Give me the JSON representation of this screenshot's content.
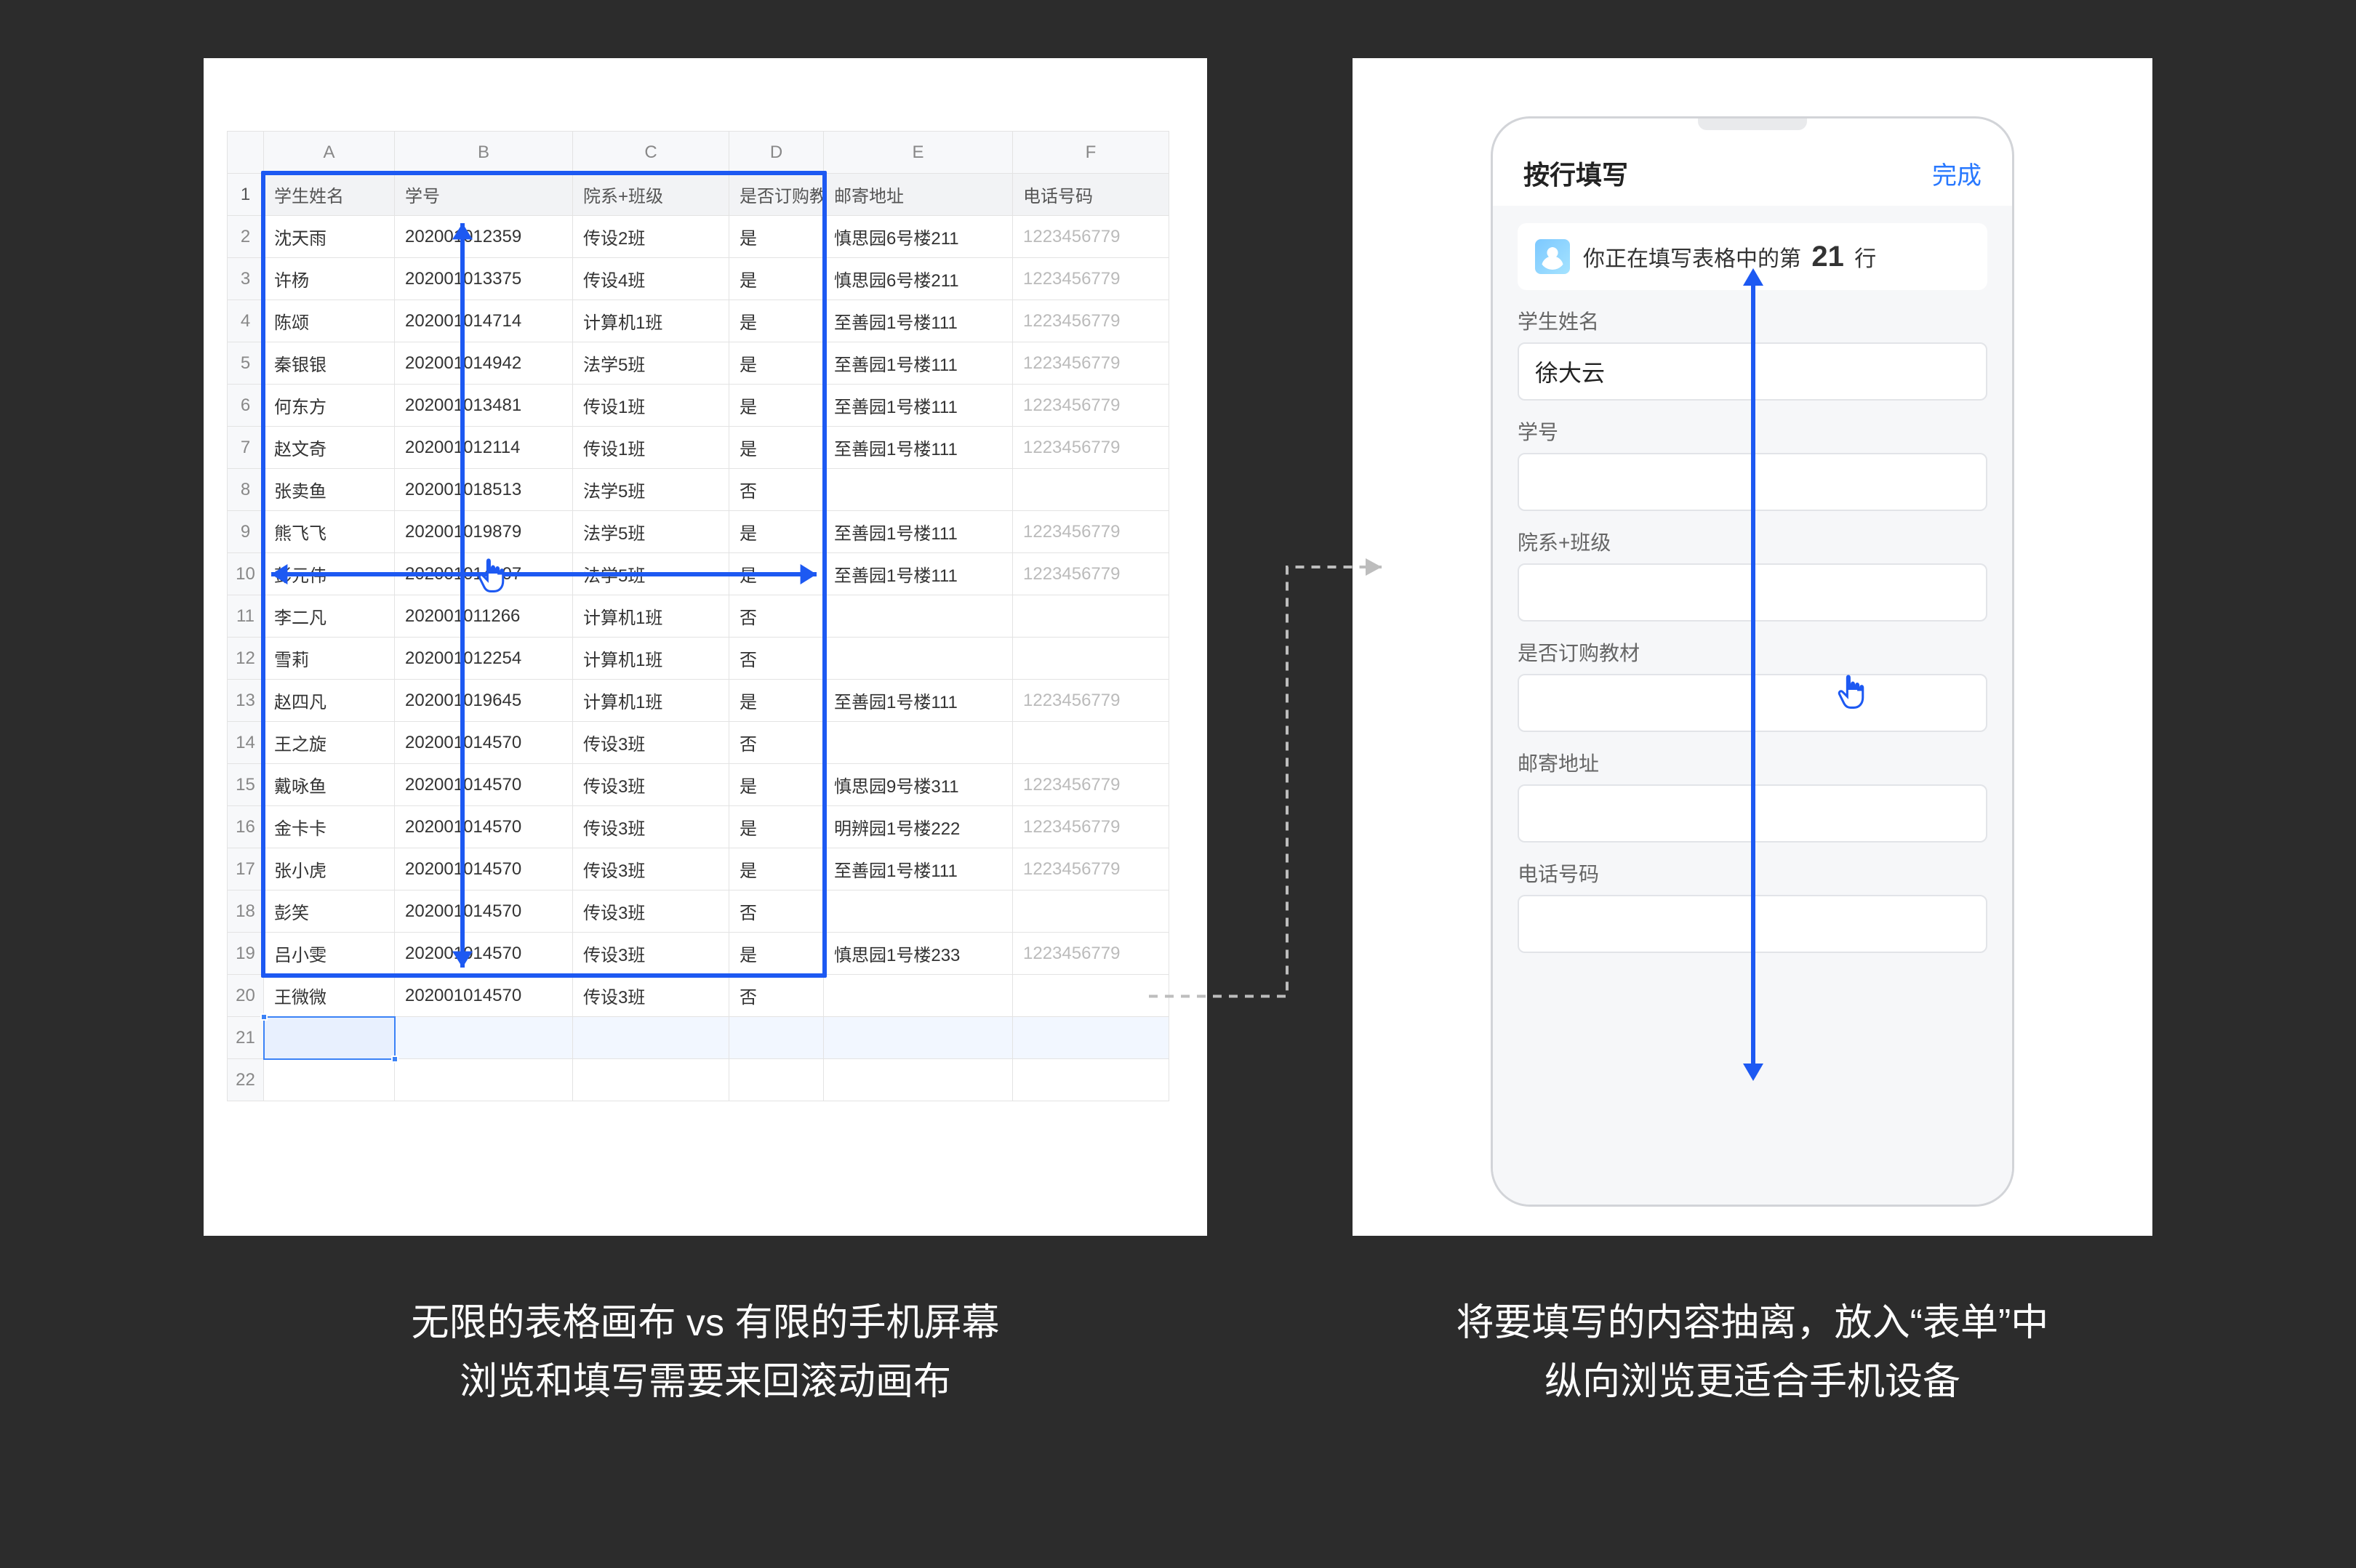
{
  "spreadsheet": {
    "col_letters": [
      "A",
      "B",
      "C",
      "D",
      "E",
      "F"
    ],
    "headers": [
      "学生姓名",
      "学号",
      "院系+班级",
      "是否订购教材",
      "邮寄地址",
      "电话号码"
    ],
    "rows": [
      [
        "沈天雨",
        "202001012359",
        "传设2班",
        "是",
        "慎思园6号楼211",
        "1223456779"
      ],
      [
        "许杨",
        "202001013375",
        "传设4班",
        "是",
        "慎思园6号楼211",
        "1223456779"
      ],
      [
        "陈颂",
        "202001014714",
        "计算机1班",
        "是",
        "至善园1号楼111",
        "1223456779"
      ],
      [
        "秦银银",
        "202001014942",
        "法学5班",
        "是",
        "至善园1号楼111",
        "1223456779"
      ],
      [
        "何东方",
        "202001013481",
        "传设1班",
        "是",
        "至善园1号楼111",
        "1223456779"
      ],
      [
        "赵文奇",
        "202001012114",
        "传设1班",
        "是",
        "至善园1号楼111",
        "1223456779"
      ],
      [
        "张卖鱼",
        "202001018513",
        "法学5班",
        "否",
        "",
        ""
      ],
      [
        "熊飞飞",
        "202001019879",
        "法学5班",
        "是",
        "至善园1号楼111",
        "1223456779"
      ],
      [
        "彭元伟",
        "202001014107",
        "法学5班",
        "是",
        "至善园1号楼111",
        "1223456779"
      ],
      [
        "李二凡",
        "202001011266",
        "计算机1班",
        "否",
        "",
        ""
      ],
      [
        "雪莉",
        "202001012254",
        "计算机1班",
        "否",
        "",
        ""
      ],
      [
        "赵四凡",
        "202001019645",
        "计算机1班",
        "是",
        "至善园1号楼111",
        "1223456779"
      ],
      [
        "王之旋",
        "202001014570",
        "传设3班",
        "否",
        "",
        ""
      ],
      [
        "戴咏鱼",
        "202001014570",
        "传设3班",
        "是",
        "慎思园9号楼311",
        "1223456779"
      ],
      [
        "金卡卡",
        "202001014570",
        "传设3班",
        "是",
        "明辨园1号楼222",
        "1223456779"
      ],
      [
        "张小虎",
        "202001014570",
        "传设3班",
        "是",
        "至善园1号楼111",
        "1223456779"
      ],
      [
        "彭笑",
        "202001014570",
        "传设3班",
        "否",
        "",
        ""
      ],
      [
        "吕小雯",
        "202001014570",
        "传设3班",
        "是",
        "慎思园1号楼233",
        "1223456779"
      ],
      [
        "王微微",
        "202001014570",
        "传设3班",
        "否",
        "",
        ""
      ]
    ],
    "empty_rows_after": 2
  },
  "mobile_form": {
    "title": "按行填写",
    "done": "完成",
    "banner_prefix": "你正在填写表格中的第",
    "banner_number": "21",
    "banner_suffix": "行",
    "fields": [
      {
        "label": "学生姓名",
        "value": "徐大云"
      },
      {
        "label": "学号",
        "value": ""
      },
      {
        "label": "院系+班级",
        "value": ""
      },
      {
        "label": "是否订购教材",
        "value": ""
      },
      {
        "label": "邮寄地址",
        "value": ""
      },
      {
        "label": "电话号码",
        "value": ""
      }
    ]
  },
  "captions": {
    "left_line1": "无限的表格画布 vs 有限的手机屏幕",
    "left_line2": "浏览和填写需要来回滚动画布",
    "right_line1": "将要填写的内容抽离，放入“表单”中",
    "right_line2": "纵向浏览更适合手机设备"
  },
  "colors": {
    "accent": "#1d59f2",
    "link": "#2878ff"
  },
  "icons": {
    "cursor": "pointer-hand-icon",
    "avatar": "user-avatar-icon"
  }
}
